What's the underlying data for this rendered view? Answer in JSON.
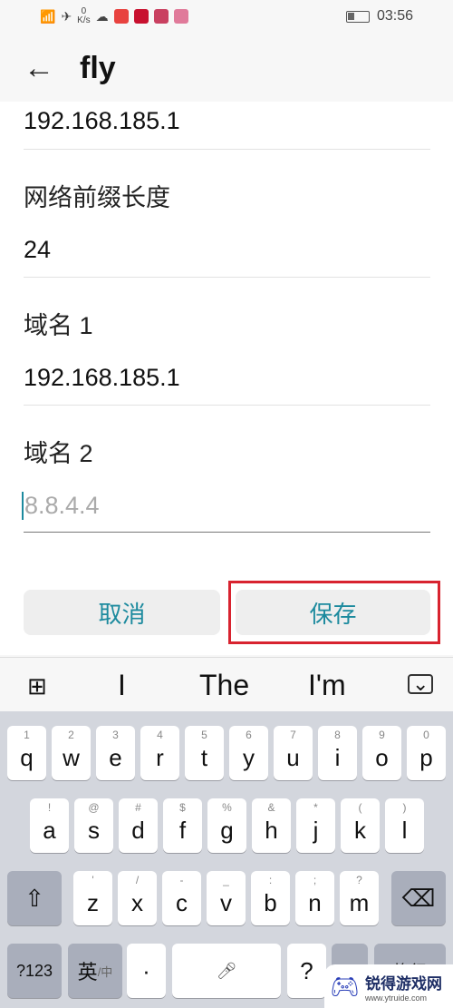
{
  "status": {
    "speed_value": "0",
    "speed_unit": "K/s",
    "time": "03:56",
    "app_colors": [
      "#e8423f",
      "#c8102e",
      "#c94060",
      "#e07a9a"
    ]
  },
  "header": {
    "title": "fly"
  },
  "form": {
    "gateway_value": "192.168.185.1",
    "prefix_label": "网络前缀长度",
    "prefix_value": "24",
    "dns1_label": "域名 1",
    "dns1_value": "192.168.185.1",
    "dns2_label": "域名 2",
    "dns2_placeholder": "8.8.4.4"
  },
  "buttons": {
    "cancel": "取消",
    "save": "保存"
  },
  "suggestions": [
    "I",
    "The",
    "I'm"
  ],
  "keyboard": {
    "row1": [
      [
        "q",
        "1"
      ],
      [
        "w",
        "2"
      ],
      [
        "e",
        "3"
      ],
      [
        "r",
        "4"
      ],
      [
        "t",
        "5"
      ],
      [
        "y",
        "6"
      ],
      [
        "u",
        "7"
      ],
      [
        "i",
        "8"
      ],
      [
        "o",
        "9"
      ],
      [
        "p",
        "0"
      ]
    ],
    "row2": [
      [
        "a",
        "!"
      ],
      [
        "s",
        "@"
      ],
      [
        "d",
        "#"
      ],
      [
        "f",
        "$"
      ],
      [
        "g",
        "%"
      ],
      [
        "h",
        "&"
      ],
      [
        "j",
        "*"
      ],
      [
        "k",
        "("
      ],
      [
        "l",
        ")"
      ]
    ],
    "row3": [
      [
        "z",
        "'"
      ],
      [
        "x",
        "/"
      ],
      [
        "c",
        "-"
      ],
      [
        "v",
        "_"
      ],
      [
        "b",
        ":"
      ],
      [
        "n",
        ";"
      ],
      [
        "m",
        "?"
      ]
    ],
    "num": "?123",
    "lang": "英",
    "lang_sub": "/中",
    "dot": "·",
    "question": "?",
    "enter": "换行"
  },
  "watermark": {
    "name": "锐得游戏网",
    "url": "www.ytruide.com"
  }
}
